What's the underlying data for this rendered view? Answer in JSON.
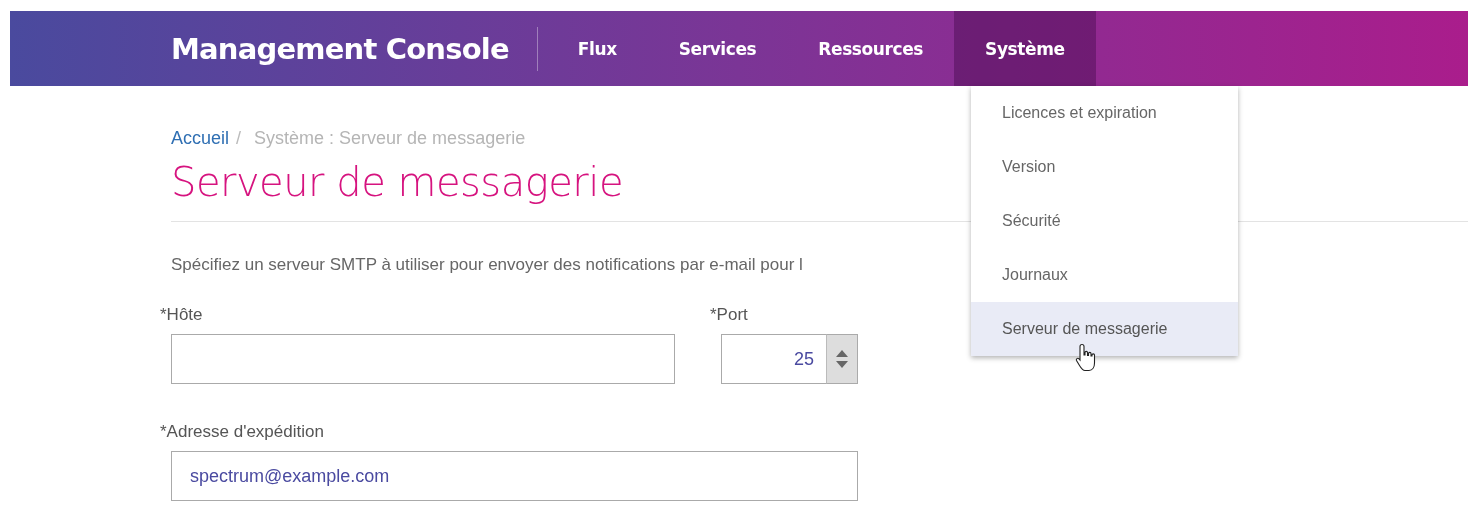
{
  "header": {
    "title": "Management Console",
    "nav": [
      {
        "label": "Flux",
        "selected": false
      },
      {
        "label": "Services",
        "selected": false
      },
      {
        "label": "Ressources",
        "selected": false
      },
      {
        "label": "Système",
        "selected": true
      }
    ]
  },
  "menu": {
    "items": [
      {
        "label": "Licences et expiration",
        "selected": false
      },
      {
        "label": "Version",
        "selected": false
      },
      {
        "label": "Sécurité",
        "selected": false
      },
      {
        "label": "Journaux",
        "selected": false
      },
      {
        "label": "Serveur de messagerie",
        "selected": true
      }
    ]
  },
  "breadcrumb": {
    "link": "Accueil",
    "separator": "/",
    "current": "Système : Serveur de messagerie"
  },
  "heading": "Serveur de messagerie",
  "description": "Spécifiez un serveur SMTP à utiliser pour envoyer des notifications par e-mail pour l",
  "form": {
    "host": {
      "label": "*Hôte"
    },
    "port": {
      "label": "*Port",
      "value": "25"
    },
    "sender": {
      "label": "*Adresse d'expédition",
      "value": "spectrum@example.com"
    }
  }
}
